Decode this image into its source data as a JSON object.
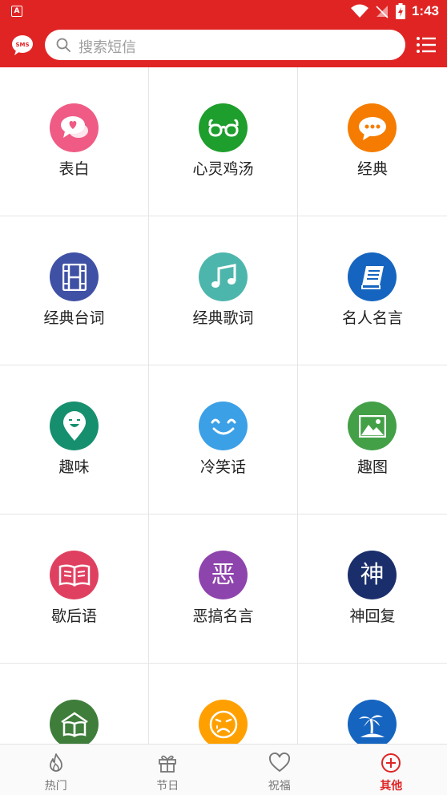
{
  "status_bar": {
    "time": "1:43",
    "app_badge": "A"
  },
  "header": {
    "logo_text": "SMS",
    "search_placeholder": "搜索短信"
  },
  "categories": [
    {
      "label": "表白",
      "icon": "love-chat-icon",
      "color": "#ef5b84"
    },
    {
      "label": "心灵鸡汤",
      "icon": "glasses-icon",
      "color": "#1e9e2c"
    },
    {
      "label": "经典",
      "icon": "chat-dots-icon",
      "color": "#f57c00"
    },
    {
      "label": "经典台词",
      "icon": "film-icon",
      "color": "#3f51a5"
    },
    {
      "label": "经典歌词",
      "icon": "music-note-icon",
      "color": "#4db6ac"
    },
    {
      "label": "名人名言",
      "icon": "book-icon",
      "color": "#1565c0"
    },
    {
      "label": "趣味",
      "icon": "funny-face-pin-icon",
      "color": "#168f6e"
    },
    {
      "label": "冷笑话",
      "icon": "smile-icon",
      "color": "#3ba0e6"
    },
    {
      "label": "趣图",
      "icon": "image-icon",
      "color": "#43a047"
    },
    {
      "label": "歇后语",
      "icon": "open-book-icon",
      "color": "#e04060"
    },
    {
      "label": "恶搞名言",
      "icon": "e-char-icon",
      "glyph": "恶",
      "color": "#8e44ad"
    },
    {
      "label": "神回复",
      "icon": "shen-char-icon",
      "glyph": "神",
      "color": "#1a2e6b"
    },
    {
      "label": "",
      "icon": "house-book-icon",
      "color": "#3f7d3b"
    },
    {
      "label": "",
      "icon": "sad-face-icon",
      "color": "#ffa000"
    },
    {
      "label": "",
      "icon": "island-palm-icon",
      "color": "#1565c0"
    }
  ],
  "bottom_nav": [
    {
      "label": "热门",
      "icon": "fire-icon",
      "active": false
    },
    {
      "label": "节日",
      "icon": "gift-icon",
      "active": false
    },
    {
      "label": "祝福",
      "icon": "heart-icon",
      "active": false
    },
    {
      "label": "其他",
      "icon": "plus-circle-icon",
      "active": true
    }
  ],
  "colors": {
    "primary": "#e02424",
    "inactive": "#777777"
  }
}
